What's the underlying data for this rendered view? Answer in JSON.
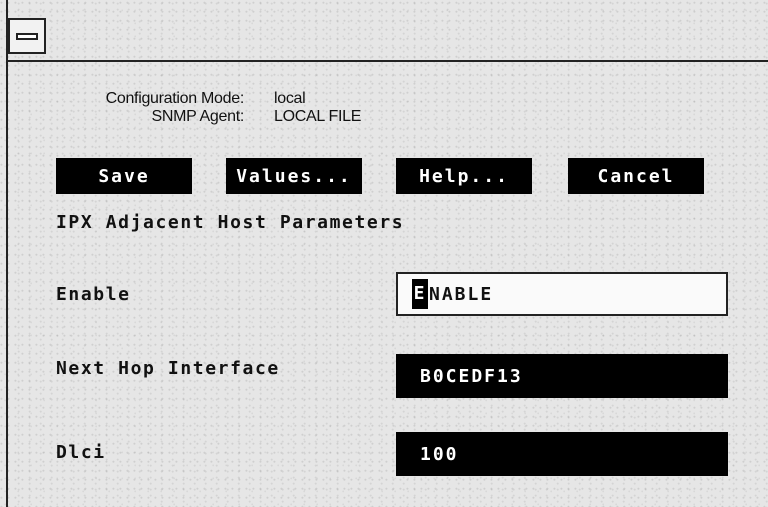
{
  "info": {
    "config_mode_label": "Configuration Mode:",
    "config_mode_value": "local",
    "snmp_agent_label": "SNMP Agent:",
    "snmp_agent_value": "LOCAL FILE"
  },
  "buttons": {
    "save": "Save",
    "values": "Values...",
    "help": "Help...",
    "cancel": "Cancel"
  },
  "heading": "IPX Adjacent Host Parameters",
  "params": {
    "enable_label": "Enable",
    "enable_value_first": "E",
    "enable_value_rest": "NABLE",
    "next_hop_label": "Next Hop Interface",
    "next_hop_value": "B0CEDF13",
    "dlci_label": "Dlci",
    "dlci_value": "100"
  },
  "icons": {
    "system_menu": "system-menu-icon"
  },
  "colors": {
    "button_bg": "#000000",
    "button_text": "#ffffff",
    "field_bg_active": "#000000"
  }
}
